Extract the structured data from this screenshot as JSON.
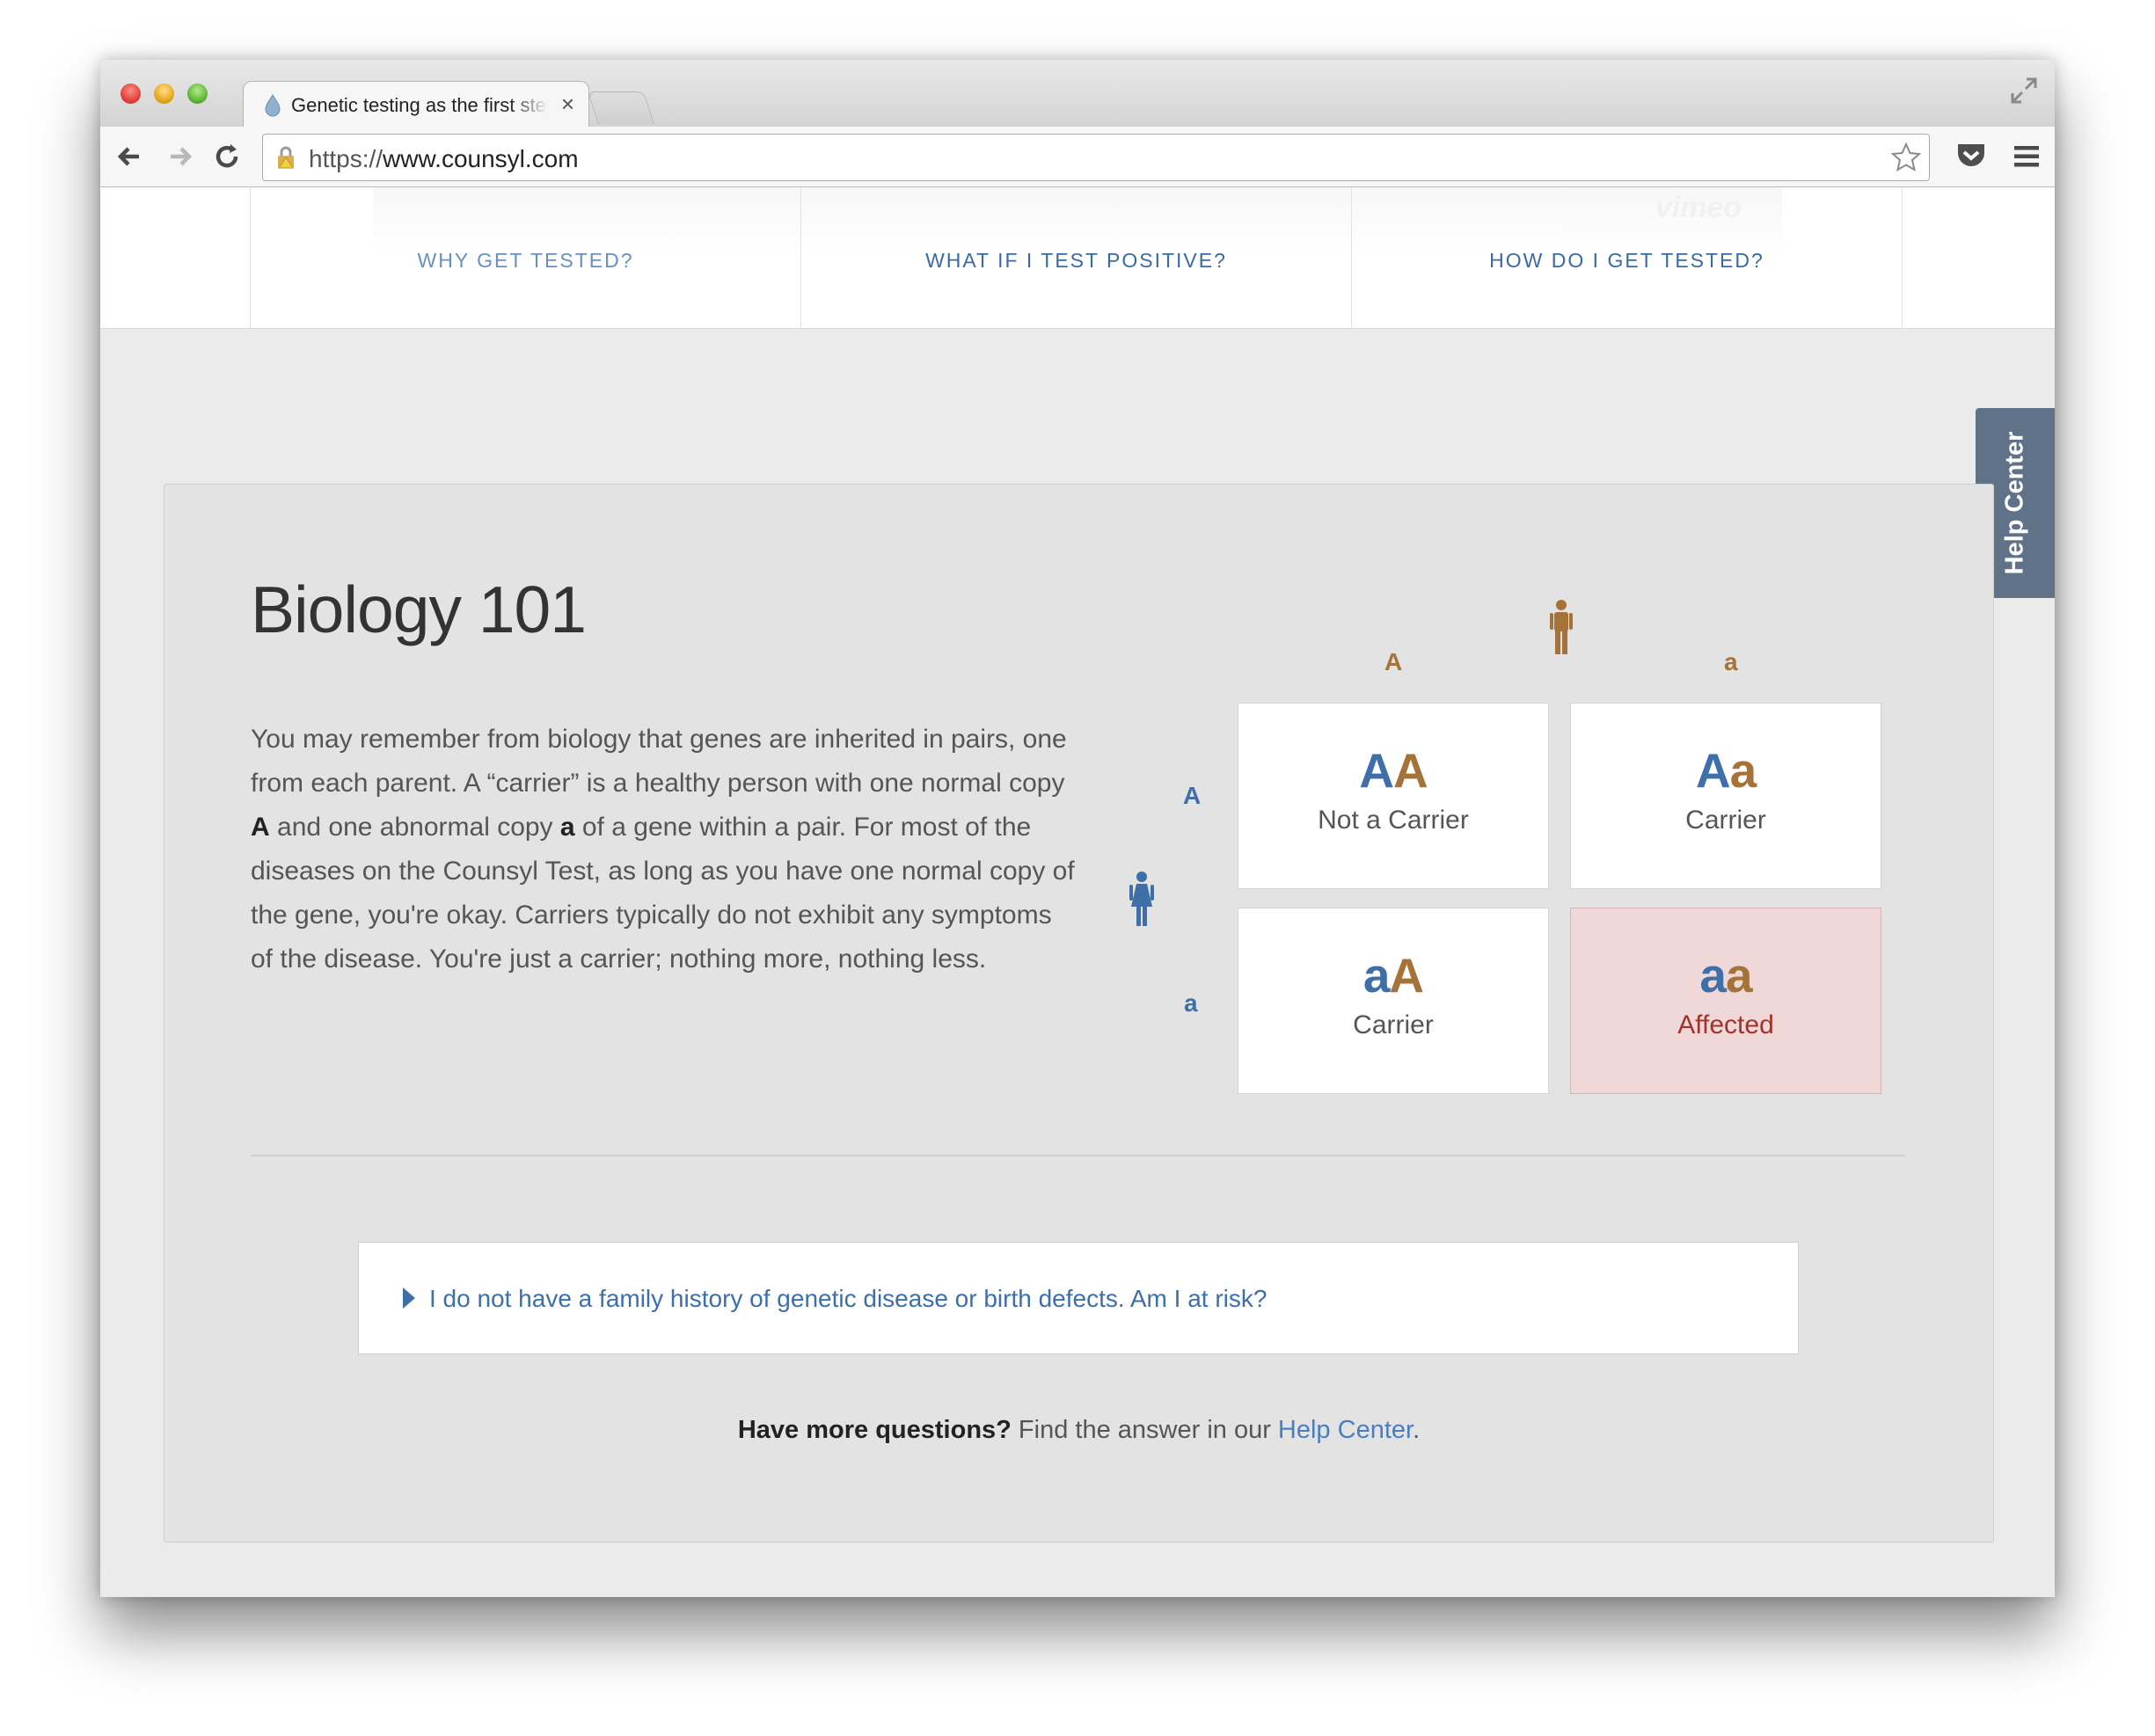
{
  "browser": {
    "tab_title": "Genetic testing as the first step",
    "url_scheme": "https://",
    "url_host": "www.counsyl.com"
  },
  "nav": {
    "items": [
      {
        "label": "WHY GET TESTED?"
      },
      {
        "label": "WHAT IF I TEST POSITIVE?"
      },
      {
        "label": "HOW DO I GET TESTED?"
      }
    ],
    "video_brand": "vimeo"
  },
  "help_tab": {
    "label": "Help Center"
  },
  "section": {
    "title": "Biology 101",
    "paragraph": {
      "p1": "You may remember from biology that genes are inherited in pairs, one from each parent. A “carrier” is a healthy person with one normal copy ",
      "b1": "A",
      "p2": " and one abnormal copy ",
      "b2": "a",
      "p3": " of a gene within a pair. For most of the diseases on the Counsyl Test, as long as you have one normal copy of the gene, you're okay. Carriers typically do not exhibit any symptoms of the disease. You're just a carrier; nothing more, nothing less."
    }
  },
  "punnett": {
    "colors": {
      "father": "#a5733a",
      "mother": "#3e6fa8",
      "affected_bg": "#f1d8d8",
      "affected_text": "#a1342a"
    },
    "father_alleles": [
      "A",
      "a"
    ],
    "mother_alleles": [
      "A",
      "a"
    ],
    "cells": [
      {
        "g1": "A",
        "g2": "A",
        "status": "Not a Carrier"
      },
      {
        "g1": "A",
        "g2": "a",
        "status": "Carrier"
      },
      {
        "g1": "a",
        "g2": "A",
        "status": "Carrier"
      },
      {
        "g1": "a",
        "g2": "a",
        "status": "Affected"
      }
    ]
  },
  "faq": {
    "question": "I do not have a family history of genetic disease or birth defects. Am I at risk?"
  },
  "footer": {
    "bold": "Have more questions?",
    "text": " Find the answer in our ",
    "link": "Help Center",
    "end": "."
  }
}
